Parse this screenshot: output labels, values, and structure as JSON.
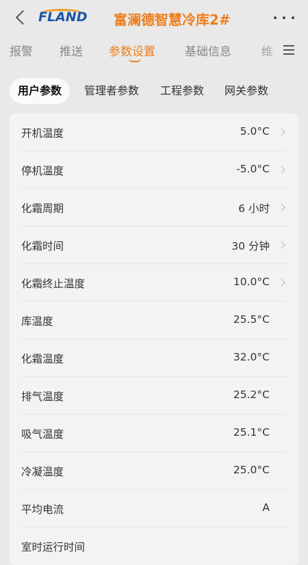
{
  "header": {
    "back_icon": "chevron-left-icon",
    "logo_text": "FLAND",
    "title": "富澜德智慧冷库2#",
    "more_icon": "more-dots-icon"
  },
  "tabs": [
    {
      "label": "报警"
    },
    {
      "label": "推送"
    },
    {
      "label": "参数设置",
      "active": true
    },
    {
      "label": "基础信息"
    },
    {
      "label": "维"
    }
  ],
  "subtabs": [
    {
      "label": "用户参数",
      "active": true
    },
    {
      "label": "管理者参数"
    },
    {
      "label": "工程参数"
    },
    {
      "label": "网关参数"
    }
  ],
  "params": [
    {
      "label": "开机温度",
      "value": "5.0°C",
      "editable": true
    },
    {
      "label": "停机温度",
      "value": "-5.0°C",
      "editable": true
    },
    {
      "label": "化霜周期",
      "value": "6 小时",
      "editable": true
    },
    {
      "label": "化霜时间",
      "value": "30 分钟",
      "editable": true
    },
    {
      "label": "化霜终止温度",
      "value": "10.0°C",
      "editable": true
    },
    {
      "label": "库温度",
      "value": "25.5°C",
      "editable": false
    },
    {
      "label": "化霜温度",
      "value": "32.0°C",
      "editable": false
    },
    {
      "label": "排气温度",
      "value": "25.2°C",
      "editable": false
    },
    {
      "label": "吸气温度",
      "value": "25.1°C",
      "editable": false
    },
    {
      "label": "冷凝温度",
      "value": "25.0°C",
      "editable": false
    },
    {
      "label": "平均电流",
      "value": "A",
      "editable": false
    },
    {
      "label": "室时运行时间",
      "value": "",
      "editable": false
    }
  ],
  "colors": {
    "accent": "#ef7d1a",
    "logo_blue": "#1d56a8",
    "background": "#e9e9e9",
    "card": "#f3f3f3"
  }
}
